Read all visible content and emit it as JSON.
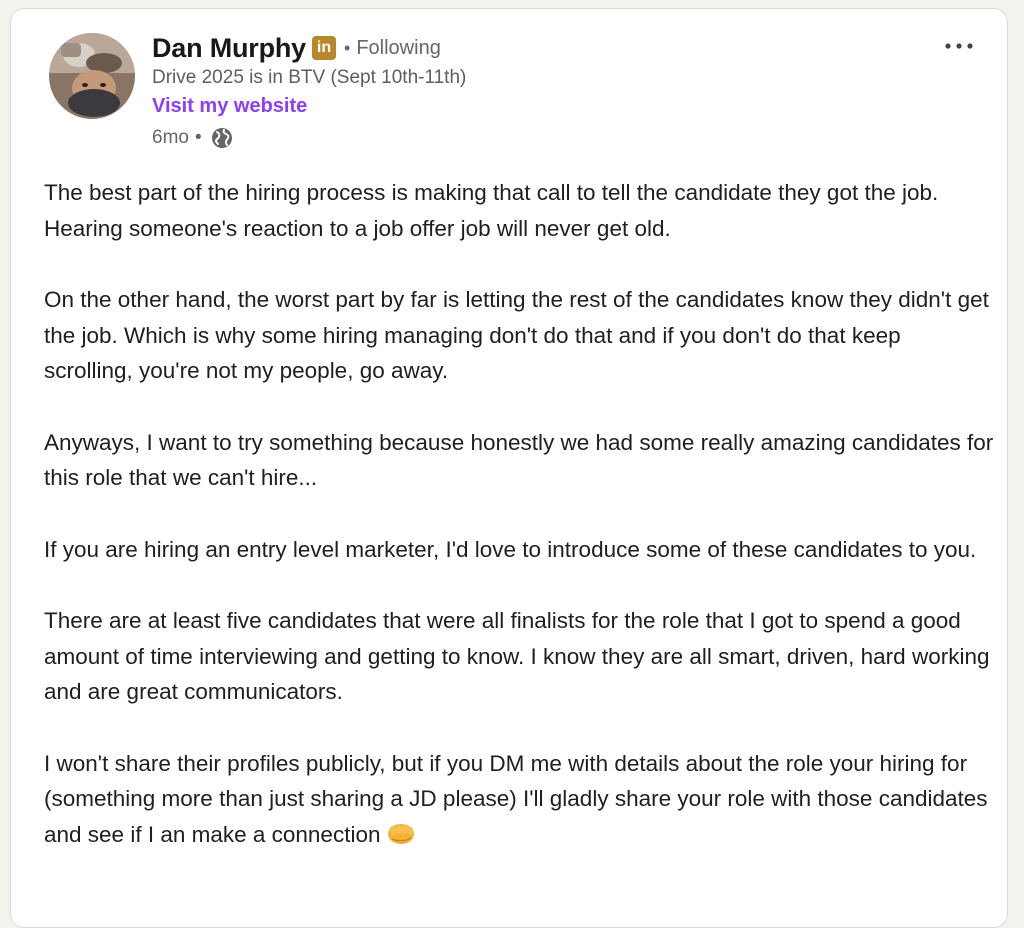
{
  "post": {
    "author": {
      "name": "Dan Murphy",
      "badge_label": "in",
      "separator": "•",
      "follow_status": "Following",
      "headline": "Drive 2025 is in BTV (Sept 10th-11th)",
      "website_link": "Visit my website",
      "time_ago": "6mo",
      "meta_separator": "•",
      "visibility_icon": "globe-icon"
    },
    "menu_icon": "more-horizontal-icon",
    "paragraphs": [
      "The best part of the hiring process is making that call to tell the candidate they got the job. Hearing someone's reaction to a job offer job will never get old.",
      "On the other hand, the worst part by far is letting the rest of the candidates know they didn't get the job. Which is why some hiring managing don't do that and if you don't do that keep scrolling, you're not my people, go away.",
      "Anyways, I want to try something because honestly we had some really amazing candidates for this role that we can't hire...",
      "If you are hiring an entry level marketer, I'd love to introduce some of these candidates to you.",
      "There are at least five candidates that were all finalists for the role that I got to spend a good amount of time interviewing and getting to know. I know they are all smart, driven, hard working and are great communicators.",
      "I won't share their profiles publicly, but if you DM me with details about the role your hiring for (something more than just sharing a JD please) I'll gladly share your role with those candidates and see if I an make a connection"
    ],
    "trailing_emoji": "fist-bump-emoji"
  },
  "colors": {
    "page_background": "#f4f2ee",
    "card_background": "#ffffff",
    "premium_badge": "#b8862b",
    "link_purple": "#8a3ffc",
    "body_text": "#1f1f1f",
    "secondary_text": "#666666"
  }
}
